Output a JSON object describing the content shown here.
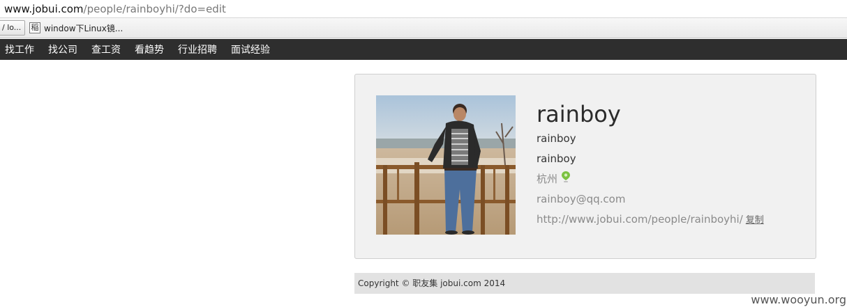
{
  "browser": {
    "url_host": "www.jobui.com",
    "url_path": "/people/rainboyhi/?do=edit",
    "bookmark_button": "/ lo...",
    "bookmark_item": {
      "favicon_text": "稲",
      "label": "window下Linux镜..."
    }
  },
  "nav": {
    "items": [
      {
        "label": "找工作"
      },
      {
        "label": "找公司"
      },
      {
        "label": "查工资"
      },
      {
        "label": "看趋势"
      },
      {
        "label": "行业招聘"
      },
      {
        "label": "面试经验"
      }
    ]
  },
  "profile": {
    "name": "rainboy",
    "line1": "rainboy",
    "line2": "rainboy",
    "city": "杭州",
    "email": "rainboy@qq.com",
    "url": "http://www.jobui.com/people/rainboyhi/",
    "copy_label": "复制"
  },
  "footer": {
    "copyright": "Copyright © 职友集 jobui.com 2014"
  },
  "watermark": "www.wooyun.org",
  "colors": {
    "nav_bg": "#2e2e2e",
    "card_bg": "#f1f1f1",
    "pin_green": "#7cc242"
  }
}
